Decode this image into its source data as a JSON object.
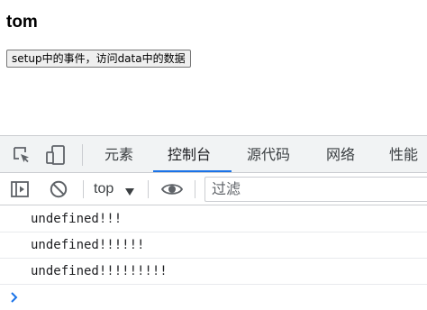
{
  "page": {
    "heading": "tom",
    "button_label": "setup中的事件，访问data中的数据"
  },
  "devtools": {
    "icons": [
      "inspect-element-icon",
      "device-toolbar-icon"
    ],
    "tabs": [
      {
        "label": "元素",
        "active": false
      },
      {
        "label": "控制台",
        "active": true
      },
      {
        "label": "源代码",
        "active": false
      },
      {
        "label": "网络",
        "active": false
      },
      {
        "label": "性能",
        "active": false
      }
    ],
    "accent_color": "#1a73e8",
    "toolbar": {
      "icons": [
        "show-sidebar-icon",
        "clear-console-icon",
        "live-expression-eye-icon"
      ],
      "context_value": "top",
      "filter_placeholder": "过滤"
    },
    "console": {
      "messages": [
        "undefined!!!",
        "undefined!!!!!!",
        "undefined!!!!!!!!!"
      ]
    }
  }
}
